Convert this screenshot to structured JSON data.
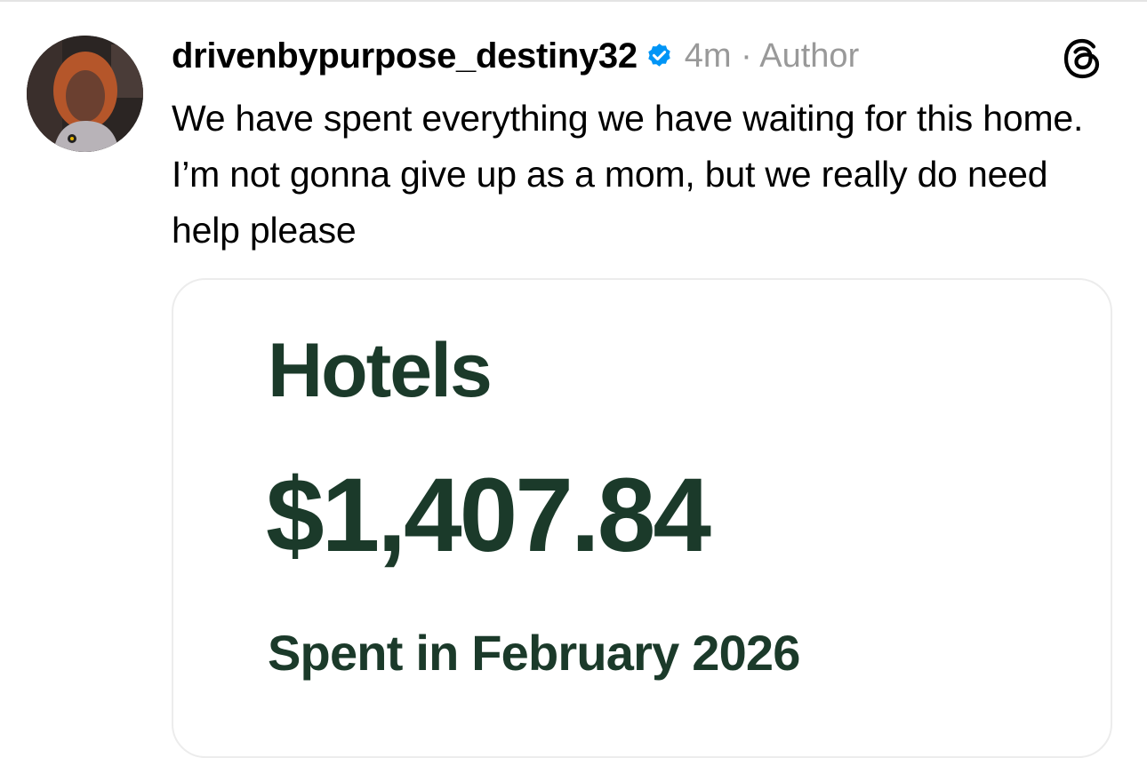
{
  "post": {
    "username": "drivenbypurpose_destiny32",
    "verified": true,
    "meta": "4m · Author",
    "text": "We have spent everything we have waiting for this home. I’m not gonna give up as a mom, but we really do need help please"
  },
  "icons": {
    "verified": "verified-badge-icon",
    "app": "threads-logo-icon"
  },
  "card": {
    "title": "Hotels",
    "amount": "$1,407.84",
    "caption": "Spent in February 2026"
  },
  "colors": {
    "verified_blue": "#0095f6",
    "card_green": "#1b3a2a",
    "meta_gray": "#999999"
  }
}
